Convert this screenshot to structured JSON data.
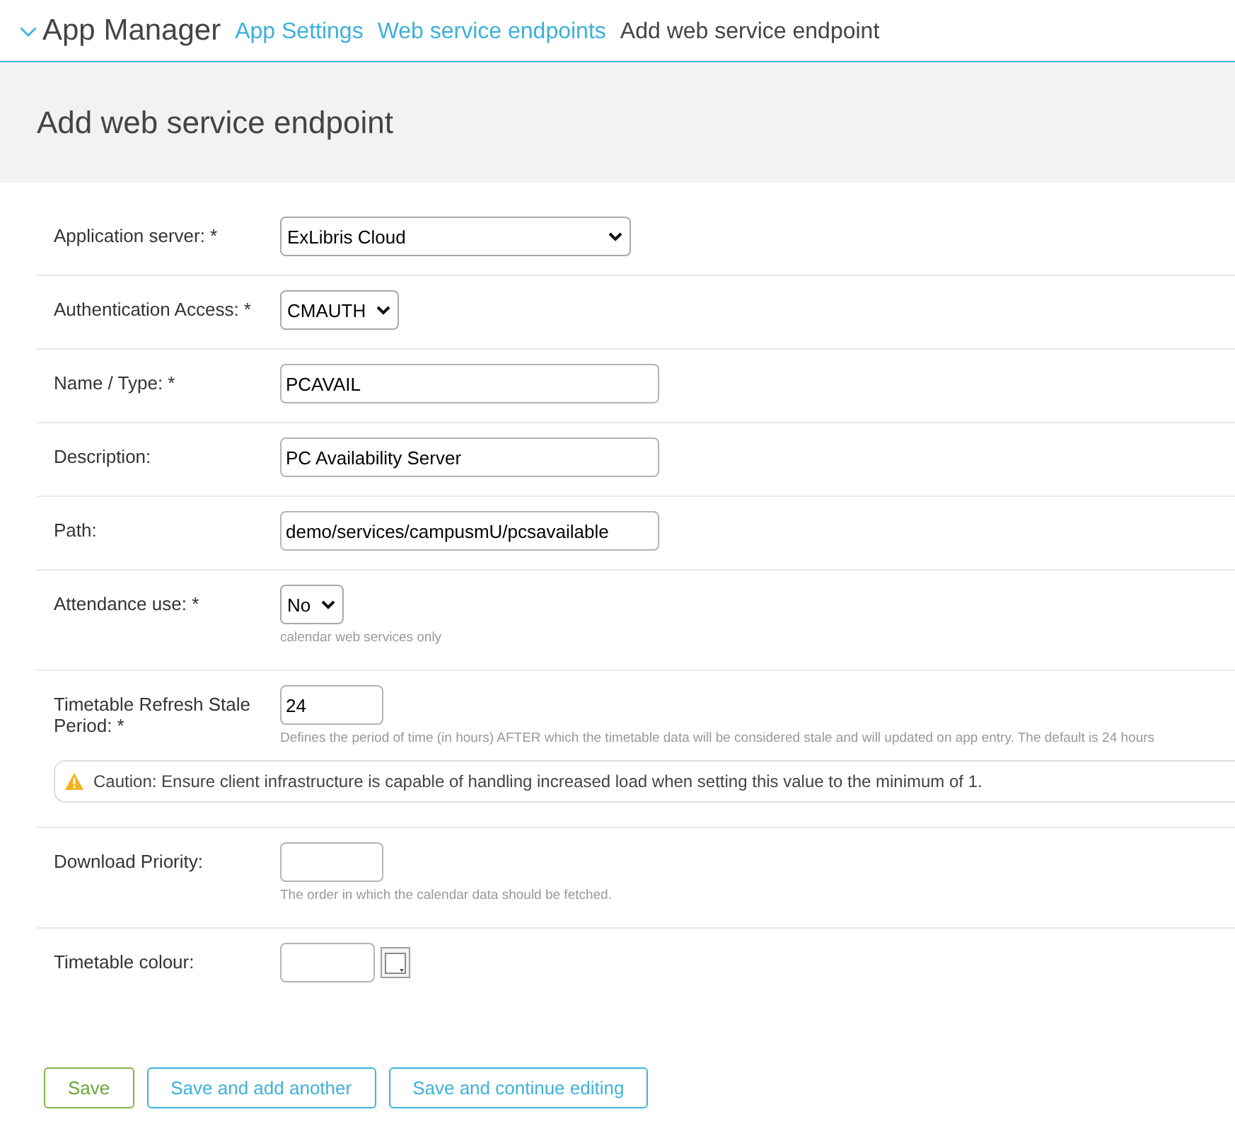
{
  "header": {
    "app_title": "App Manager",
    "breadcrumbs": [
      {
        "label": "App Settings",
        "kind": "link"
      },
      {
        "label": "Web service endpoints",
        "kind": "link"
      },
      {
        "label": "Add web service endpoint",
        "kind": "current"
      }
    ]
  },
  "page_title": "Add web service endpoint",
  "form": {
    "fields": [
      {
        "label": "Application server: *",
        "kind": "select",
        "value": "ExLibris Cloud"
      },
      {
        "label": "Authentication Access: *",
        "kind": "select",
        "value": "CMAUTH"
      },
      {
        "label": "Name / Type: *",
        "kind": "text",
        "value": "PCAVAIL"
      },
      {
        "label": "Description:",
        "kind": "text",
        "value": "PC Availability Server"
      },
      {
        "label": "Path:",
        "kind": "text",
        "value": "demo/services/campusmU/pcsavailable"
      },
      {
        "label": "Attendance use: *",
        "kind": "select",
        "value": "No",
        "help": "calendar web services only"
      },
      {
        "label": "Timetable Refresh Stale Period: *",
        "kind": "number",
        "value": "24",
        "help": "Defines the period of time (in hours) AFTER which the timetable data will be considered stale and will updated on app entry. The default is 24 hours",
        "warning": "Caution: Ensure client infrastructure is capable of handling increased load when setting this value to the minimum of 1."
      },
      {
        "label": "Download Priority:",
        "kind": "number",
        "help": "The order in which the calendar data should be fetched."
      },
      {
        "label": "Timetable colour:",
        "kind": "color"
      }
    ]
  },
  "buttons": [
    {
      "label": "Save",
      "kind": "primary"
    },
    {
      "label": "Save and add another",
      "kind": "secondary"
    },
    {
      "label": "Save and continue editing",
      "kind": "secondary"
    }
  ]
}
